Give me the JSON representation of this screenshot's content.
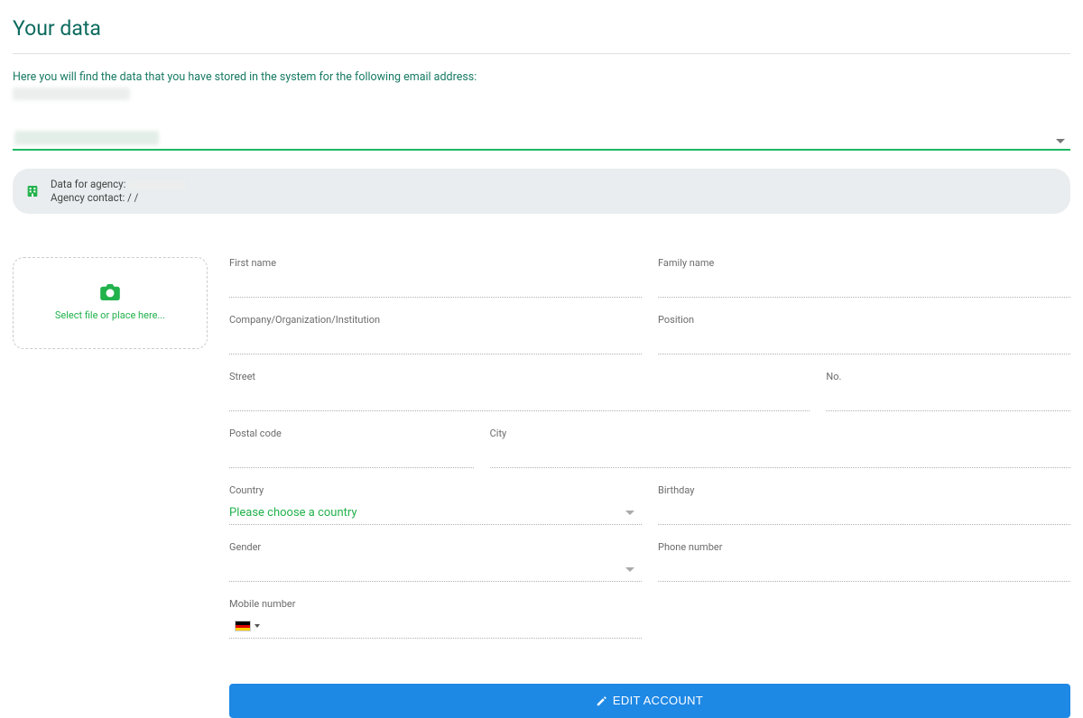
{
  "page": {
    "title": "Your data",
    "intro": "Here you will find the data that you have stored in the system for the following email address:"
  },
  "agency_info": {
    "line1_prefix": "Data for agency:",
    "line2": "Agency contact: / /"
  },
  "upload": {
    "label": "Select file or place here..."
  },
  "fields": {
    "first_name": {
      "label": "First name",
      "value": ""
    },
    "family_name": {
      "label": "Family name",
      "value": ""
    },
    "company": {
      "label": "Company/Organization/Institution",
      "value": ""
    },
    "position": {
      "label": "Position",
      "value": ""
    },
    "street": {
      "label": "Street",
      "value": ""
    },
    "no": {
      "label": "No.",
      "value": ""
    },
    "postal_code": {
      "label": "Postal code",
      "value": ""
    },
    "city": {
      "label": "City",
      "value": ""
    },
    "country": {
      "label": "Country",
      "placeholder": "Please choose a country"
    },
    "birthday": {
      "label": "Birthday",
      "value": ""
    },
    "gender": {
      "label": "Gender",
      "value": ""
    },
    "phone": {
      "label": "Phone number",
      "value": ""
    },
    "mobile": {
      "label": "Mobile number",
      "value": ""
    }
  },
  "buttons": {
    "edit_account": "EDIT ACCOUNT"
  },
  "colors": {
    "accent_teal": "#0d6b5f",
    "accent_green": "#22b24c",
    "primary_blue": "#1e88e5"
  }
}
